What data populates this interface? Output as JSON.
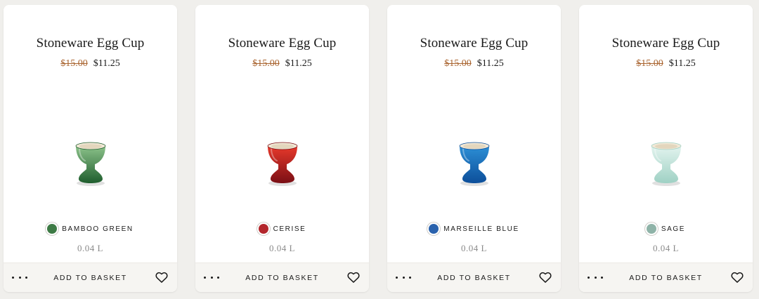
{
  "products": [
    {
      "title": "Stoneware Egg Cup",
      "price_old": "$15.00",
      "price_new": "$11.25",
      "colour_name": "BAMBOO GREEN",
      "swatch_color": "#3d7a45",
      "cup_light": "#8cc28a",
      "cup_dark": "#1f5e2e",
      "capacity": "0.04 L",
      "add_label": "ADD TO BASKET",
      "more_icon": "more-dots-icon",
      "fav_icon": "heart-icon"
    },
    {
      "title": "Stoneware Egg Cup",
      "price_old": "$15.00",
      "price_new": "$11.25",
      "colour_name": "CERISE",
      "swatch_color": "#b3262c",
      "cup_light": "#e8392b",
      "cup_dark": "#7a0f15",
      "capacity": "0.04 L",
      "add_label": "ADD TO BASKET",
      "more_icon": "more-dots-icon",
      "fav_icon": "heart-icon"
    },
    {
      "title": "Stoneware Egg Cup",
      "price_old": "$15.00",
      "price_new": "$11.25",
      "colour_name": "MARSEILLE BLUE",
      "swatch_color": "#2a62ad",
      "cup_light": "#2c8fd6",
      "cup_dark": "#0d4f9a",
      "capacity": "0.04 L",
      "add_label": "ADD TO BASKET",
      "more_icon": "more-dots-icon",
      "fav_icon": "heart-icon"
    },
    {
      "title": "Stoneware Egg Cup",
      "price_old": "$15.00",
      "price_new": "$11.25",
      "colour_name": "SAGE",
      "swatch_color": "#8fb3a8",
      "cup_light": "#e2f3ee",
      "cup_dark": "#9fd1c4",
      "capacity": "0.04 L",
      "add_label": "ADD TO BASKET",
      "more_icon": "more-dots-icon",
      "fav_icon": "heart-icon"
    }
  ]
}
